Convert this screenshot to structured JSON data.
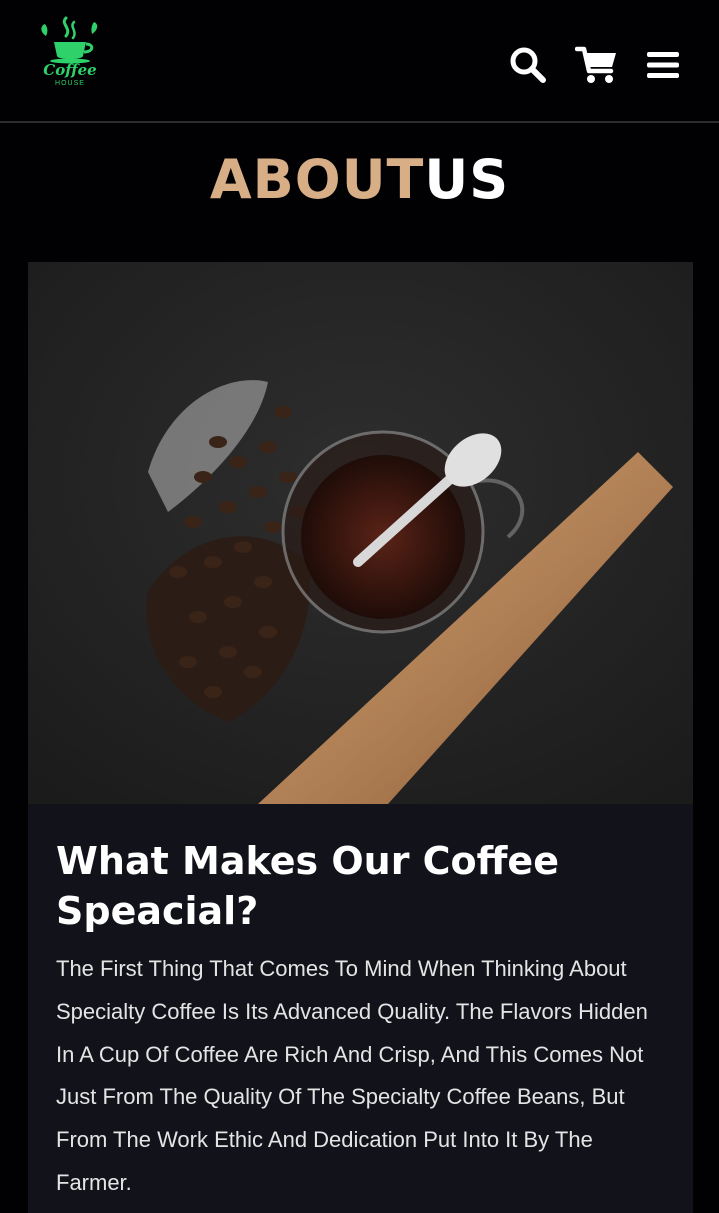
{
  "header": {
    "logo_text": "Coffee",
    "logo_sub": "HOUSE",
    "icons": [
      "search-icon",
      "cart-icon",
      "menu-icon"
    ]
  },
  "section": {
    "title_part1": "ABOUT",
    "title_part2": "US"
  },
  "card": {
    "heading": "What Makes Our Coffee Speacial?",
    "body": "The First Thing That Comes To Mind When Thinking About Specialty Coffee Is Its Advanced Quality. The Flavors Hidden In A Cup Of Coffee Are Rich And Crisp, And This Comes Not Just From The Quality Of The Specialty Coffee Beans, But From The Work Ethic And Dedication Put Into It By The Farmer."
  },
  "colors": {
    "background": "#010103",
    "accent": "#d7ae85",
    "logo_green": "#2fd26a",
    "card": "#12131a"
  }
}
